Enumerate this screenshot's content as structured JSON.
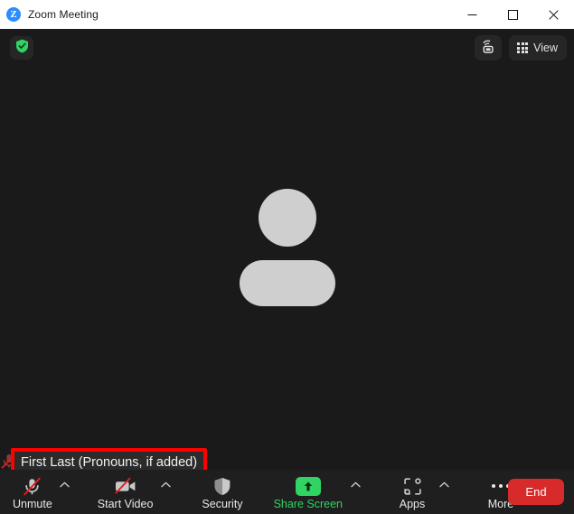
{
  "window": {
    "title": "Zoom Meeting",
    "logo_letter": "Z",
    "controls": {
      "minimize": "minimize-icon",
      "maximize": "maximize-icon",
      "close": "close-icon"
    }
  },
  "stage": {
    "encryption_icon": "shield-check-icon",
    "audio_output_icon": "speaker-output-icon",
    "view_button_label": "View",
    "view_button_icon": "grid-icon",
    "avatar_icon": "default-user-avatar",
    "participant": {
      "name_label": "First Last (Pronouns, if added)",
      "mic_status_icon": "microphone-muted-icon",
      "highlight_color": "#ff0000"
    }
  },
  "toolbar": {
    "items": [
      {
        "label": "Unmute",
        "icon": "microphone-muted-icon",
        "has_caret": true
      },
      {
        "label": "Start Video",
        "icon": "camera-off-icon",
        "has_caret": true
      },
      {
        "label": "Security",
        "icon": "shield-icon",
        "has_caret": false
      },
      {
        "label": "Share Screen",
        "icon": "share-screen-arrow-icon",
        "has_caret": true
      },
      {
        "label": "Apps",
        "icon": "apps-icon",
        "has_caret": true
      },
      {
        "label": "More",
        "icon": "more-dots-icon",
        "has_caret": false
      }
    ],
    "end_button_label": "End",
    "accent_green": "#2fd463",
    "end_red": "#d72b2b"
  }
}
